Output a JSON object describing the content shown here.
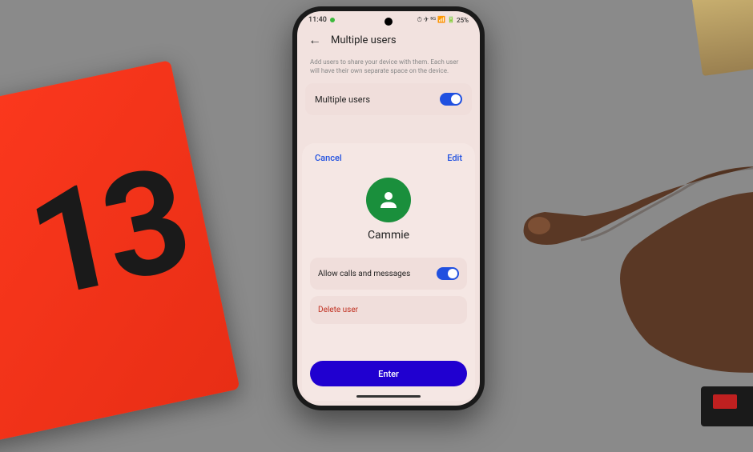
{
  "status": {
    "time": "11:40",
    "battery": "25%",
    "signal_icons": "⏱ ✈ ⁵ᴳ 📶 🔋"
  },
  "header": {
    "title": "Multiple users"
  },
  "description": "Add users to share your device with them. Each user will have their own separate space on the device.",
  "settings": {
    "multiple_users_label": "Multiple users"
  },
  "sheet": {
    "cancel": "Cancel",
    "edit": "Edit",
    "user_name": "Cammie",
    "allow_calls_label": "Allow calls and messages",
    "delete_label": "Delete user",
    "enter_label": "Enter"
  },
  "box": {
    "number": "13"
  }
}
